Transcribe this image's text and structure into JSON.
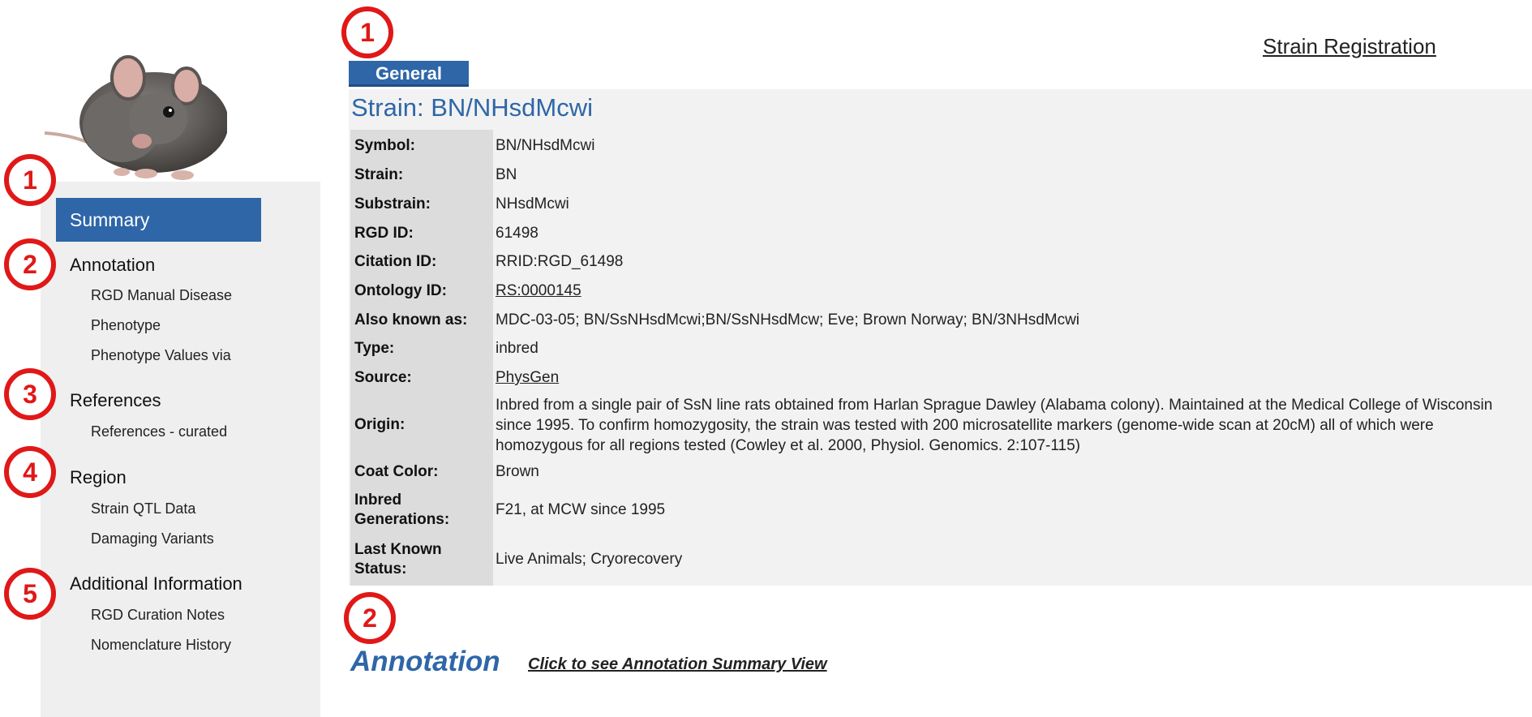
{
  "sidebar": {
    "summary_label": "Summary",
    "sections": [
      {
        "heading": "Annotation",
        "items": [
          "RGD Manual Disease",
          "Phenotype",
          "Phenotype Values via"
        ]
      },
      {
        "heading": "References",
        "items": [
          "References - curated"
        ]
      },
      {
        "heading": "Region",
        "items": [
          "Strain QTL Data",
          "Damaging Variants"
        ]
      },
      {
        "heading": "Additional Information",
        "items": [
          "RGD Curation Notes",
          "Nomenclature History"
        ]
      }
    ]
  },
  "markers": {
    "sidebar": [
      "1",
      "2",
      "3",
      "4",
      "5"
    ],
    "main": [
      "1",
      "2"
    ]
  },
  "header": {
    "registration_link": "Strain Registration",
    "general_tab": "General"
  },
  "strain": {
    "title": "Strain: BN/NHsdMcwi",
    "rows": [
      {
        "label": "Symbol:",
        "value": "BN/NHsdMcwi"
      },
      {
        "label": "Strain:",
        "value": "BN"
      },
      {
        "label": "Substrain:",
        "value": "NHsdMcwi"
      },
      {
        "label": "RGD ID:",
        "value": "61498"
      },
      {
        "label": "Citation ID:",
        "value": "RRID:RGD_61498"
      },
      {
        "label": "Ontology ID:",
        "value": "RS:0000145"
      },
      {
        "label": "Also known as:",
        "value": "MDC-03-05; BN/SsNHsdMcwi;BN/SsNHsdMcw; Eve; Brown Norway; BN/3NHsdMcwi"
      },
      {
        "label": "Type:",
        "value": "inbred"
      },
      {
        "label": "Source:",
        "value": "PhysGen"
      },
      {
        "label": "Origin:",
        "value": "Inbred from a single pair of SsN line rats obtained from Harlan Sprague Dawley (Alabama colony). Maintained at the Medical College of Wisconsin since 1995. To confirm homozygosity, the strain was tested with 200 microsatellite markers (genome-wide scan at 20cM) all of which were homozygous for all regions tested (Cowley et al. 2000, Physiol. Genomics. 2:107-115)"
      },
      {
        "label": "Coat Color:",
        "value": "Brown"
      },
      {
        "label": "Inbred Generations:",
        "value": "F21, at MCW since 1995"
      },
      {
        "label": "Last Known Status:",
        "value": "Live Animals; Cryorecovery"
      }
    ]
  },
  "annotation": {
    "heading": "Annotation",
    "summary_view_link": "Click to see Annotation Summary View"
  }
}
